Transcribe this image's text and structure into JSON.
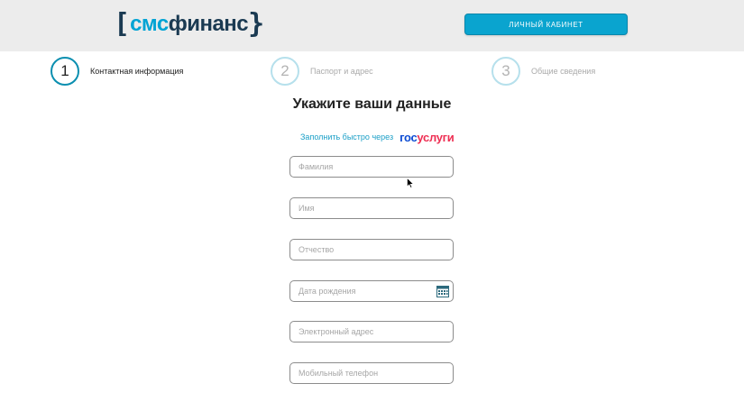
{
  "header": {
    "logo": {
      "bracket_open": "[",
      "sms": "смс",
      "fin": "финанс",
      "bracket_close": "}"
    },
    "cabinet_button": "ЛИЧНЫЙ КАБИНЕТ"
  },
  "steps": [
    {
      "number": "1",
      "label": "Контактная информация",
      "active": true
    },
    {
      "number": "2",
      "label": "Паспорт и адрес",
      "active": false
    },
    {
      "number": "3",
      "label": "Общие сведения",
      "active": false
    }
  ],
  "form": {
    "title": "Укажите ваши данные",
    "gosuslugi_text": "Заполнить быстро через",
    "gosuslugi_logo": {
      "part1": "гос",
      "part2": "услуги"
    },
    "fields": [
      {
        "placeholder": "Фамилия",
        "value": ""
      },
      {
        "placeholder": "Имя",
        "value": ""
      },
      {
        "placeholder": "Отчество",
        "value": ""
      },
      {
        "placeholder": "Дата рождения",
        "value": "",
        "icon": "calendar-icon"
      },
      {
        "placeholder": "Электронный адрес",
        "value": ""
      },
      {
        "placeholder": "Мобильный телефон",
        "value": ""
      }
    ]
  },
  "colors": {
    "accent": "#0aa4cf",
    "brand_dark": "#1a3a52",
    "gos_blue": "#0d4cd3",
    "gos_red": "#ee2f53"
  }
}
